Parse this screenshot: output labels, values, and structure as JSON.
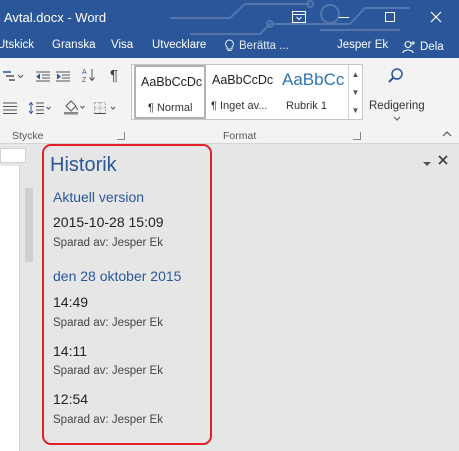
{
  "window": {
    "title": "Avtal.docx - Word",
    "controls": {
      "ribbon_display": "ribbon-display-icon",
      "minimize": "minimize-icon",
      "maximize": "maximize-icon",
      "close": "close-icon"
    }
  },
  "ribbon_tabs": {
    "items": [
      {
        "label": "Utskick"
      },
      {
        "label": "Granska"
      },
      {
        "label": "Visa"
      },
      {
        "label": "Utvecklare"
      }
    ],
    "tell_me": "Berätta ...",
    "user": "Jesper Ek",
    "share": "Dela"
  },
  "ribbon": {
    "paragraph_group_label": "Stycke",
    "styles_group_label": "Format",
    "styles": [
      {
        "sample": "AaBbCcDc",
        "name": "¶ Normal",
        "selected": true
      },
      {
        "sample": "AaBbCcDc",
        "name": "¶ Inget av...",
        "selected": false
      },
      {
        "sample": "AaBbCc",
        "name": "Rubrik 1",
        "selected": false
      }
    ],
    "editing_label": "Redigering"
  },
  "history_pane": {
    "title": "Historik",
    "current_heading": "Aktuell version",
    "current_version": {
      "time": "2015-10-28 15:09",
      "saved_by": "Sparad av: Jesper Ek"
    },
    "date_heading": "den 28 oktober 2015",
    "versions": [
      {
        "time": "14:49",
        "saved_by": "Sparad av: Jesper Ek"
      },
      {
        "time": "14:11",
        "saved_by": "Sparad av: Jesper Ek"
      },
      {
        "time": "12:54",
        "saved_by": "Sparad av: Jesper Ek"
      }
    ]
  },
  "colors": {
    "accent": "#2b579a",
    "highlight_border": "#e0202a",
    "pane_background": "#e6e6e6",
    "ribbon_background": "#f3f3f3"
  }
}
